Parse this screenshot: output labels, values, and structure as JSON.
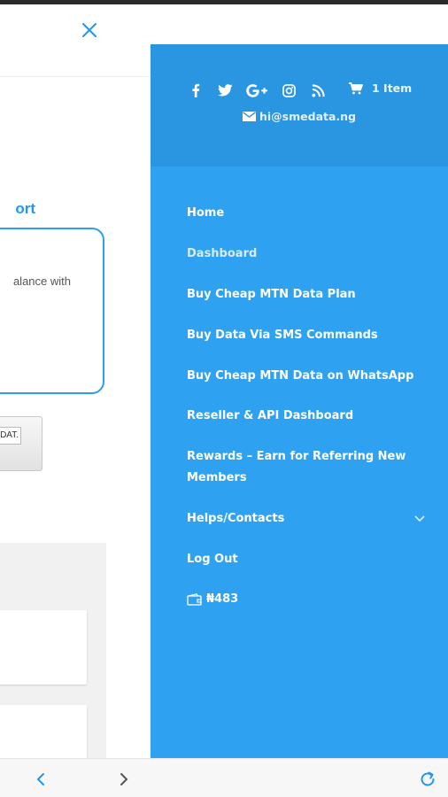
{
  "background": {
    "heading": "ort",
    "card_text": "alance with",
    "button_text": "DAT."
  },
  "drawer": {
    "social_icons": [
      "facebook-icon",
      "twitter-icon",
      "google-plus-icon",
      "instagram-icon",
      "rss-icon"
    ],
    "cart_label": "1 Item",
    "email": "hi@smedata.ng",
    "menu": {
      "home": "Home",
      "dashboard": "Dashboard",
      "buy_mtn": "Buy Cheap MTN Data Plan",
      "sms": "Buy Data Via SMS Commands",
      "whatsapp": "Buy Cheap MTN Data on WhatsApp",
      "reseller": "Reseller & API Dashboard",
      "rewards_line1": "Rewards – Earn for Referring New",
      "rewards_line2": "Members",
      "helps": "Helps/Contacts",
      "logout": "Log Out",
      "wallet_amount": "₦483"
    }
  },
  "colors": {
    "drawer_bg": "#2ea2f0",
    "drawer_header_bg": "#2a95e0",
    "accent": "#2196f3"
  }
}
